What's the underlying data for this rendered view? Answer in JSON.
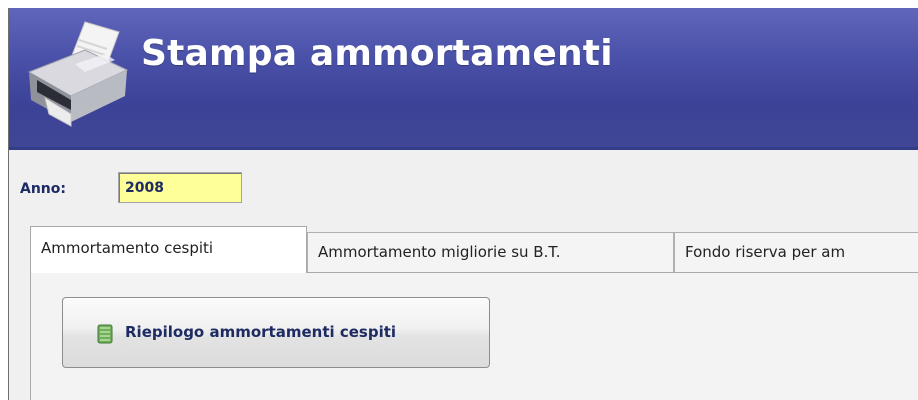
{
  "header": {
    "title": "Stampa ammortamenti",
    "icon": "printer-icon"
  },
  "form": {
    "anno_label": "Anno:",
    "anno_value": "2008"
  },
  "tabs": [
    {
      "label": "Ammortamento cespiti",
      "active": true
    },
    {
      "label": "Ammortamento migliorie su B.T.",
      "active": false
    },
    {
      "label": "Fondo riserva per am",
      "active": false
    }
  ],
  "panel": {
    "report_button": {
      "label": "Riepilogo ammortamenti cespiti",
      "icon": "report-book-icon"
    }
  },
  "colors": {
    "header_top": "#5f66bb",
    "header_bottom": "#343b8e",
    "input_background": "#ffff99",
    "label_text": "#1e2a62"
  }
}
